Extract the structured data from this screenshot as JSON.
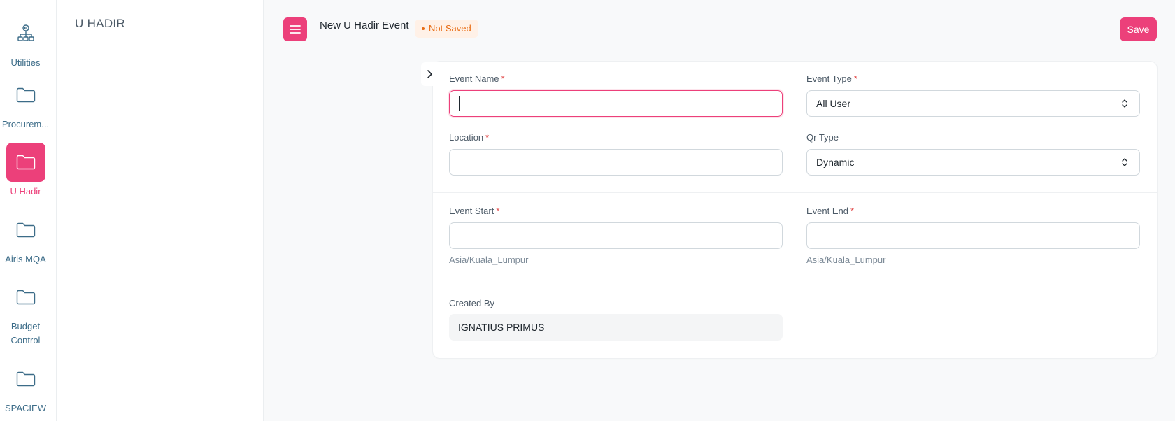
{
  "sidebar": {
    "items": [
      {
        "label": "Utilities",
        "icon": "sitemap-icon"
      },
      {
        "label": "Procurem...",
        "icon": "folder-icon"
      },
      {
        "label": "U Hadir",
        "icon": "folder-icon",
        "active": true
      },
      {
        "label": "Airis MQA",
        "icon": "folder-icon"
      },
      {
        "label": "Budget Control",
        "icon": "folder-icon"
      },
      {
        "label": "SPACIEW",
        "icon": "folder-icon"
      }
    ]
  },
  "module": {
    "title": "U HADIR"
  },
  "header": {
    "title": "New U Hadir Event",
    "status": "Not Saved",
    "save_label": "Save"
  },
  "form": {
    "event_name": {
      "label": "Event Name",
      "value": ""
    },
    "event_type": {
      "label": "Event Type",
      "value": "All User"
    },
    "location": {
      "label": "Location",
      "value": ""
    },
    "qr_type": {
      "label": "Qr Type",
      "value": "Dynamic"
    },
    "event_start": {
      "label": "Event Start",
      "value": "",
      "hint": "Asia/Kuala_Lumpur"
    },
    "event_end": {
      "label": "Event End",
      "value": "",
      "hint": "Asia/Kuala_Lumpur"
    },
    "created_by": {
      "label": "Created By",
      "value": "IGNATIUS PRIMUS"
    },
    "required_mark": "*"
  },
  "colors": {
    "accent": "#ec407a",
    "rail_text": "#3c6c88",
    "status": "#e86c13"
  }
}
